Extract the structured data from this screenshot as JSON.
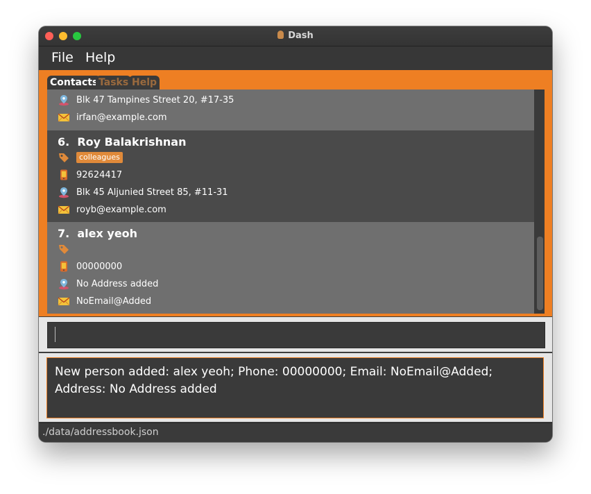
{
  "window": {
    "title": "Dash"
  },
  "menu": {
    "file": "File",
    "help": "Help"
  },
  "tabs": [
    {
      "label": "Contacts",
      "active": true
    },
    {
      "label": "Tasks",
      "active": false
    },
    {
      "label": "Help",
      "active": false
    }
  ],
  "contacts": {
    "partial": {
      "address": "Blk 47 Tampines Street 20, #17-35",
      "email": "irfan@example.com"
    },
    "items": [
      {
        "index": "6.",
        "name": "Roy Balakrishnan",
        "tags": [
          "colleagues"
        ],
        "phone": "92624417",
        "address": "Blk 45 Aljunied Street 85, #11-31",
        "email": "royb@example.com"
      },
      {
        "index": "7.",
        "name": "alex yeoh",
        "tags": [],
        "phone": "00000000",
        "address": "No Address added",
        "email": "NoEmail@Added"
      }
    ]
  },
  "command": {
    "value": ""
  },
  "result": {
    "message": "New person added: alex yeoh; Phone: 00000000; Email: NoEmail@Added; Address: No Address added"
  },
  "status": {
    "path": "./data/addressbook.json"
  },
  "colors": {
    "accent": "#ee7f23",
    "panel": "#3c3c3c",
    "card_light": "#6f6f6f",
    "card_dark": "#4a4a4a",
    "tag": "#e08a3a"
  },
  "icons": [
    "location-pin-icon",
    "envelope-icon",
    "tag-icon",
    "phone-icon"
  ]
}
